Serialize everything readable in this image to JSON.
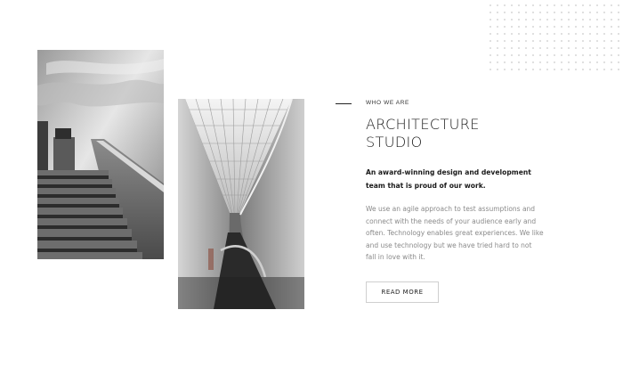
{
  "section": {
    "eyebrow": "WHO WE ARE",
    "title": "ARCHITECTURE STUDIO",
    "lead": "An award-winning design and development team that is proud of our work.",
    "body": "We use an agile approach to test assumptions and connect with the needs of your audience early and often. Technology enables great experiences. We like and use technology but we have tried hard to not fall in love with it.",
    "button_label": "READ MORE"
  },
  "images": {
    "left": "staircase-photo",
    "right": "interior-atrium-photo"
  },
  "colors": {
    "text_dark": "#1b1b1b",
    "text_muted": "#8a8a8a",
    "button_border": "#cfcfcf",
    "background": "#ffffff"
  }
}
